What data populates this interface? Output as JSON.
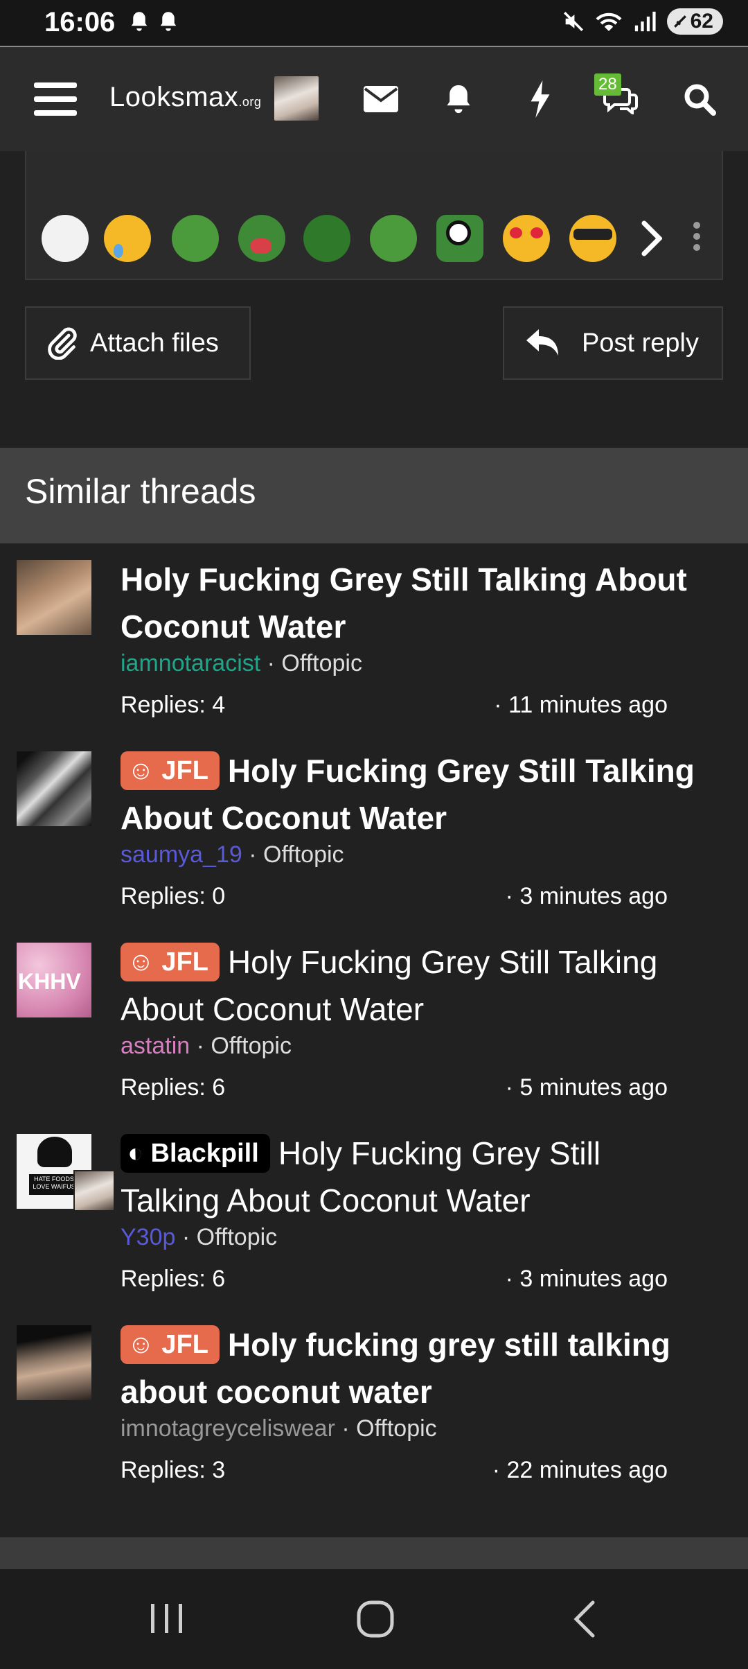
{
  "status_bar": {
    "time": "16:06",
    "battery": "62"
  },
  "header": {
    "logo_main": "Looksmax",
    "logo_suffix": ".org",
    "notif_count": "28"
  },
  "emoji_bar": {
    "emojis": [
      "wojak-emoji",
      "crying-emoji",
      "pepe-laugh-emoji",
      "pepe-scream-emoji",
      "pepe-grin-emoji",
      "pepe-ok-emoji",
      "pepe-eye-emoji",
      "heart-eyes-emoji",
      "sunglasses-emoji"
    ]
  },
  "actions": {
    "attach_label": "Attach files",
    "post_reply_label": "Post reply"
  },
  "similar": {
    "heading": "Similar threads",
    "threads": [
      {
        "prefix": "",
        "title": "Holy Fucking Grey Still Talking About Coconut Water",
        "bold": true,
        "author": "iamnotaracist",
        "author_color": "#1fa58a",
        "forum": "Offtopic",
        "replies": "Replies: 4",
        "time": "· 11 minutes ago"
      },
      {
        "prefix": "JFL",
        "title": "Holy Fucking Grey Still Talking About Coconut Water",
        "bold": true,
        "author": "saumya_19",
        "author_color": "#5a5ad6",
        "forum": "Offtopic",
        "replies": "Replies: 0",
        "time": "· 3 minutes ago"
      },
      {
        "prefix": "JFL",
        "title": "Holy Fucking Grey Still Talking About Coconut Water",
        "bold": false,
        "author": "astatin",
        "author_color": "#d77fc0",
        "forum": "Offtopic",
        "replies": "Replies: 6",
        "time": "· 5 minutes ago"
      },
      {
        "prefix": "Blackpill",
        "title": "Holy Fucking Grey Still Talking About Coconut Water",
        "bold": false,
        "author": "Y30p",
        "author_color": "#5a5ad6",
        "forum": "Offtopic",
        "replies": "Replies: 6",
        "time": "· 3 minutes ago"
      },
      {
        "prefix": "JFL",
        "title": "Holy fucking grey still talking about coconut water",
        "bold": true,
        "author": "imnotagreyceliswear",
        "author_color": "#9a9a9a",
        "forum": "Offtopic",
        "replies": "Replies: 3",
        "time": "· 22 minutes ago"
      }
    ],
    "avatar_text_3": "KHHV",
    "avatar_text_4": "HATE FOODS LOVE WAIFUS"
  },
  "colors": {
    "prefix_jfl": "#e66b4d",
    "prefix_blackpill": "#000000",
    "notif_badge": "#66bb36"
  }
}
